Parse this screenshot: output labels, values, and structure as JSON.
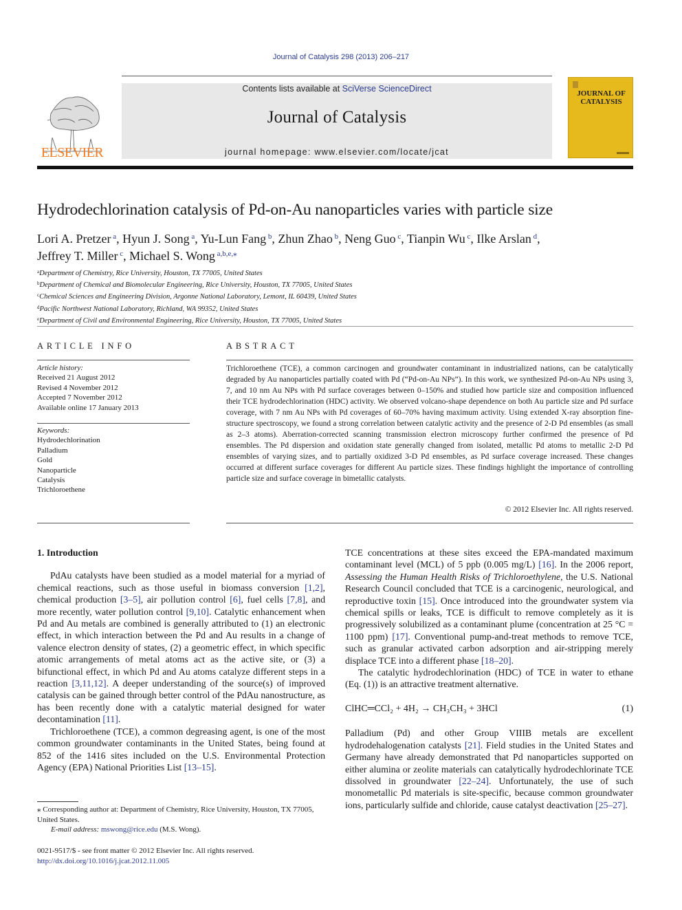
{
  "header": {
    "citation": "Journal of Catalysis 298 (2013) 206–217",
    "contents_prefix": "Contents lists available at ",
    "contents_link": "SciVerse ScienceDirect",
    "journal_title": "Journal of Catalysis",
    "homepage_prefix": "journal homepage: ",
    "homepage_url": "www.elsevier.com/locate/jcat",
    "publisher": "ELSEVIER",
    "cover_title_line1": "JOURNAL OF",
    "cover_title_line2": "CATALYSIS"
  },
  "colors": {
    "link": "#2a3b8f",
    "elsevier_orange": "#f07b22",
    "cover_yellow": "#e6b91c",
    "masthead_gray": "#e8e8e8"
  },
  "article": {
    "title": "Hydrodechlorination catalysis of Pd-on-Au nanoparticles varies with particle size",
    "authors": [
      {
        "name": "Lori A. Pretzer",
        "aff": "a",
        "sep": ", "
      },
      {
        "name": "Hyun J. Song",
        "aff": "a",
        "sep": ", "
      },
      {
        "name": "Yu-Lun Fang",
        "aff": "b",
        "sep": ", "
      },
      {
        "name": "Zhun Zhao",
        "aff": "b",
        "sep": ", "
      },
      {
        "name": "Neng Guo",
        "aff": "c",
        "sep": ", "
      },
      {
        "name": "Tianpin Wu",
        "aff": "c",
        "sep": ", "
      },
      {
        "name": "Ilke Arslan",
        "aff": "d",
        "sep": ","
      },
      {
        "name": "Jeffrey T. Miller",
        "aff": "c",
        "sep": ", "
      },
      {
        "name": "Michael S. Wong",
        "aff": "a,b,e,⁎",
        "sep": ""
      }
    ],
    "affiliations": [
      {
        "key": "a",
        "text": "Department of Chemistry, Rice University, Houston, TX 77005, United States"
      },
      {
        "key": "b",
        "text": "Department of Chemical and Biomolecular Engineering, Rice University, Houston, TX 77005, United States"
      },
      {
        "key": "c",
        "text": "Chemical Sciences and Engineering Division, Argonne National Laboratory, Lemont, IL 60439, United States"
      },
      {
        "key": "d",
        "text": "Pacific Northwest National Laboratory, Richland, WA 99352, United States"
      },
      {
        "key": "e",
        "text": "Department of Civil and Environmental Engineering, Rice University, Houston, TX 77005, United States"
      }
    ]
  },
  "article_info": {
    "label": "ARTICLE INFO",
    "history_head": "Article history:",
    "history": [
      "Received 21 August 2012",
      "Revised 4 November 2012",
      "Accepted 7 November 2012",
      "Available online 17 January 2013"
    ],
    "keywords_head": "Keywords:",
    "keywords": [
      "Hydrodechlorination",
      "Palladium",
      "Gold",
      "Nanoparticle",
      "Catalysis",
      "Trichloroethene"
    ]
  },
  "abstract": {
    "label": "ABSTRACT",
    "text": "Trichloroethene (TCE), a common carcinogen and groundwater contaminant in industrialized nations, can be catalytically degraded by Au nanoparticles partially coated with Pd (“Pd-on-Au NPs”). In this work, we synthesized Pd-on-Au NPs using 3, 7, and 10 nm Au NPs with Pd surface coverages between 0–150% and studied how particle size and composition influenced their TCE hydrodechlorination (HDC) activity. We observed volcano-shape dependence on both Au particle size and Pd surface coverage, with 7 nm Au NPs with Pd coverages of 60–70% having maximum activity. Using extended X-ray absorption fine-structure spectroscopy, we found a strong correlation between catalytic activity and the presence of 2-D Pd ensembles (as small as 2–3 atoms). Aberration-corrected scanning transmission electron microscopy further confirmed the presence of Pd ensembles. The Pd dispersion and oxidation state generally changed from isolated, metallic Pd atoms to metallic 2-D Pd ensembles of varying sizes, and to partially oxidized 3-D Pd ensembles, as Pd surface coverage increased. These changes occurred at different surface coverages for different Au particle sizes. These findings highlight the importance of controlling particle size and surface coverage in bimetallic catalysts.",
    "copyright": "© 2012 Elsevier Inc. All rights reserved."
  },
  "body": {
    "section_heading": "1. Introduction",
    "p1": [
      {
        "t": "PdAu catalysts have been studied as a model material for a myriad of chemical reactions, such as those useful in biomass conversion "
      },
      {
        "ref": "[1,2]"
      },
      {
        "t": ", chemical production "
      },
      {
        "ref": "[3–5]"
      },
      {
        "t": ", air pollution control "
      },
      {
        "ref": "[6]"
      },
      {
        "t": ", fuel cells "
      },
      {
        "ref": "[7,8]"
      },
      {
        "t": ", and more recently, water pollution control "
      },
      {
        "ref": "[9,10]"
      },
      {
        "t": ". Catalytic enhancement when Pd and Au metals are combined is generally attributed to (1) an electronic effect, in which interaction between the Pd and Au results in a change of valence electron density of states, (2) a geometric effect, in which specific atomic arrangements of metal atoms act as the active site, or (3) a bifunctional effect, in which Pd and Au atoms catalyze different steps in a reaction "
      },
      {
        "ref": "[3,11,12]"
      },
      {
        "t": ". A deeper understanding of the source(s) of improved catalysis can be gained through better control of the PdAu nanostructure, as has been recently done with a catalytic material designed for water decontamination "
      },
      {
        "ref": "[11]"
      },
      {
        "t": "."
      }
    ],
    "p2": [
      {
        "t": "Trichloroethene (TCE), a common degreasing agent, is one of the most common groundwater contaminants in the United States, being found at 852 of the 1416 sites included on the U.S. Environmental Protection Agency (EPA) National Priorities List "
      },
      {
        "ref": "[13–15]"
      },
      {
        "t": "."
      }
    ],
    "p3": [
      {
        "t": "TCE concentrations at these sites exceed the EPA-mandated maximum contaminant level (MCL) of 5 ppb (0.005 mg/L) "
      },
      {
        "ref": "[16]"
      },
      {
        "t": ". In the 2006 report, "
      },
      {
        "em": "Assessing the Human Health Risks of Trichloroethylene"
      },
      {
        "t": ", the U.S. National Research Council concluded that TCE is a carcinogenic, neurological, and reproductive toxin "
      },
      {
        "ref": "[15]"
      },
      {
        "t": ". Once introduced into the groundwater system via chemical spills or leaks, TCE is difficult to remove completely as it is progressively solubilized as a contaminant plume (concentration at 25 °C = 1100 ppm) "
      },
      {
        "ref": "[17]"
      },
      {
        "t": ". Conventional pump-and-treat methods to remove TCE, such as granular activated carbon adsorption and air-stripping merely displace TCE into a different phase "
      },
      {
        "ref": "[18–20]"
      },
      {
        "t": "."
      }
    ],
    "p4": [
      {
        "t": "The catalytic hydrodechlorination (HDC) of TCE in water to ethane (Eq. (1)) is an attractive treatment alternative."
      }
    ],
    "equation": {
      "lhs": "ClHC═CCl₂ + 4H₂ → CH₃CH₃ + 3HCl",
      "number": "(1)"
    },
    "p5": [
      {
        "t": "Palladium (Pd) and other Group VIIIB metals are excellent hydrodehalogenation catalysts "
      },
      {
        "ref": "[21]"
      },
      {
        "t": ". Field studies in the United States and Germany have already demonstrated that Pd nanoparticles supported on either alumina or zeolite materials can catalytically hydrodechlorinate TCE dissolved in groundwater "
      },
      {
        "ref": "[22–24]"
      },
      {
        "t": ". Unfortunately, the use of such monometallic Pd materials is site-specific, because common groundwater ions, particularly sulfide and chloride, cause catalyst deactivation "
      },
      {
        "ref": "[25–27]"
      },
      {
        "t": "."
      }
    ]
  },
  "footnotes": {
    "corresponding": "⁎ Corresponding author at: Department of Chemistry, Rice University, Houston, TX 77005, United States.",
    "email_label": "E-mail address: ",
    "email": "mswong@rice.edu",
    "email_suffix": " (M.S. Wong).",
    "front_matter": "0021-9517/$ - see front matter © 2012 Elsevier Inc. All rights reserved.",
    "doi": "http://dx.doi.org/10.1016/j.jcat.2012.11.005"
  }
}
